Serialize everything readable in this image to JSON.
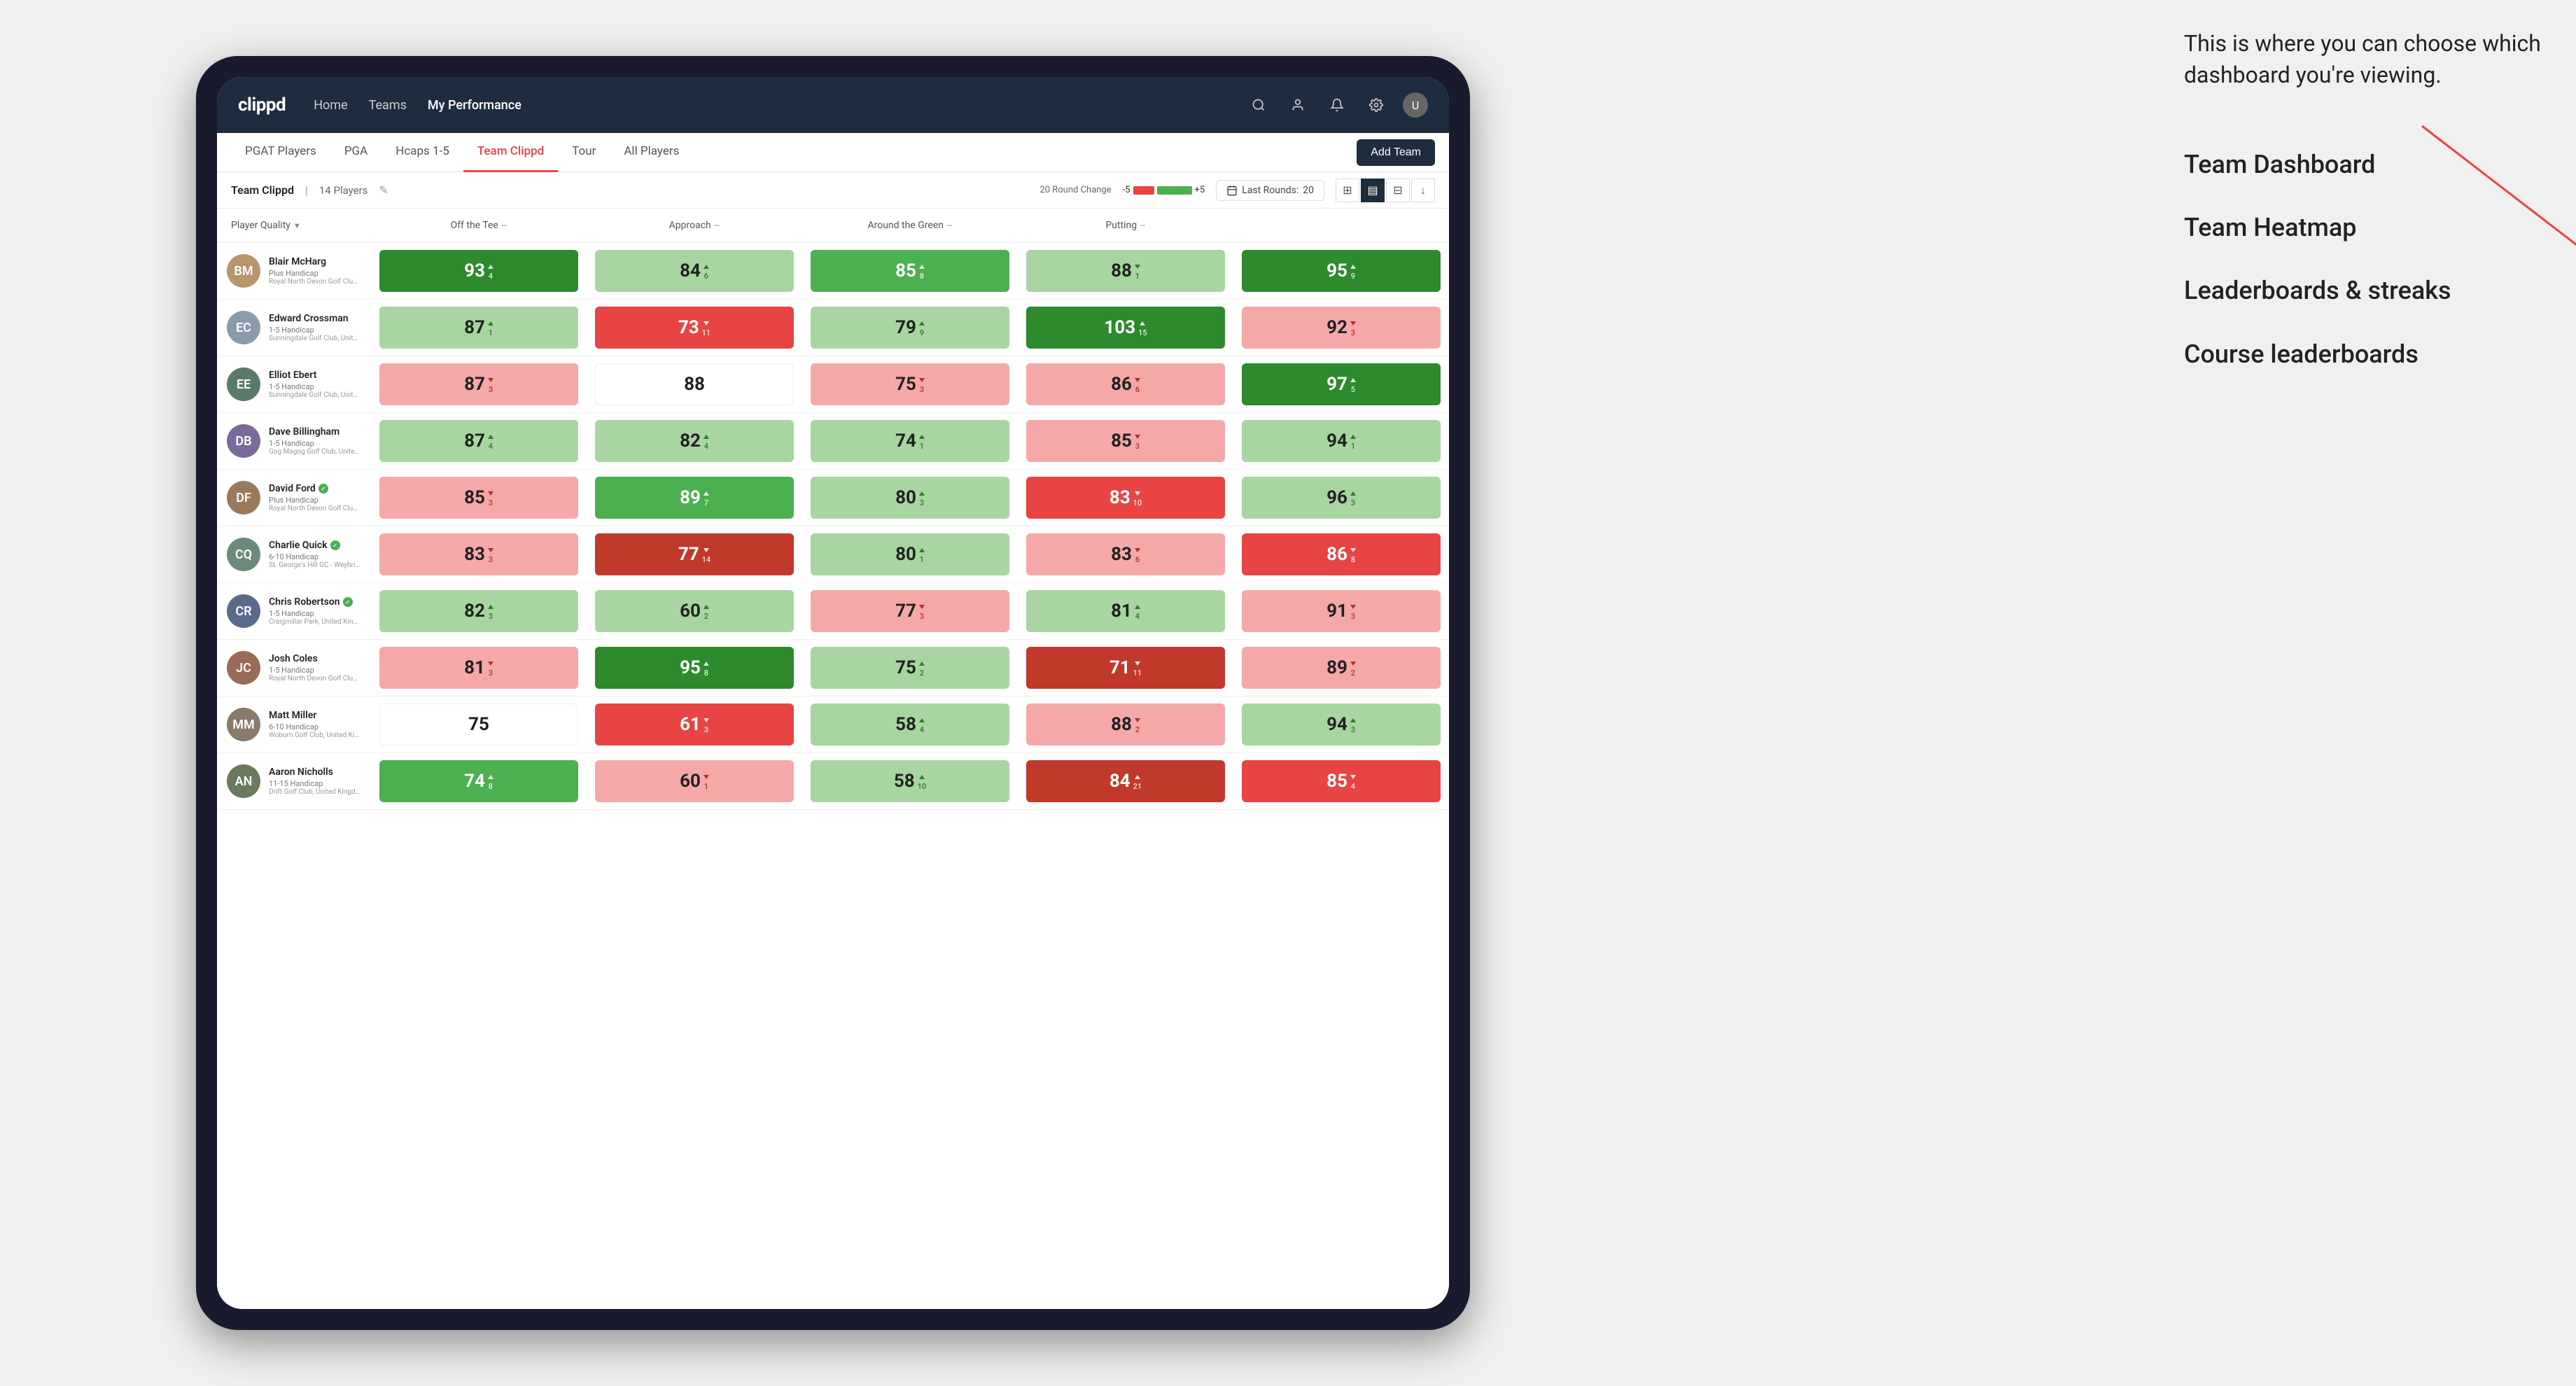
{
  "annotation": {
    "text": "This is where you can choose which dashboard you're viewing.",
    "options": [
      "Team Dashboard",
      "Team Heatmap",
      "Leaderboards & streaks",
      "Course leaderboards"
    ]
  },
  "navbar": {
    "logo": "clippd",
    "links": [
      {
        "label": "Home",
        "active": false
      },
      {
        "label": "Teams",
        "active": false
      },
      {
        "label": "My Performance",
        "active": true
      }
    ],
    "icons": [
      "search",
      "person",
      "notifications",
      "settings",
      "avatar"
    ]
  },
  "subnav": {
    "tabs": [
      {
        "label": "PGAT Players",
        "active": false
      },
      {
        "label": "PGA",
        "active": false
      },
      {
        "label": "Hcaps 1-5",
        "active": false
      },
      {
        "label": "Team Clippd",
        "active": true
      },
      {
        "label": "Tour",
        "active": false
      },
      {
        "label": "All Players",
        "active": false
      }
    ],
    "add_team_label": "Add Team"
  },
  "team_bar": {
    "name": "Team Clippd",
    "separator": "|",
    "count": "14 Players",
    "round_change_label": "20 Round Change",
    "range_neg": "-5",
    "range_pos": "+5",
    "last_rounds_label": "Last Rounds:",
    "last_rounds_value": "20"
  },
  "table": {
    "columns": [
      {
        "label": "Player Quality",
        "sortable": true
      },
      {
        "label": "Off the Tee",
        "sortable": true
      },
      {
        "label": "Approach",
        "sortable": true
      },
      {
        "label": "Around the Green",
        "sortable": true
      },
      {
        "label": "Putting",
        "sortable": true
      }
    ],
    "players": [
      {
        "name": "Blair McHarg",
        "handicap": "Plus Handicap",
        "club": "Royal North Devon Golf Club, United Kingdom",
        "avatar_color": "#b8956a",
        "avatar_initials": "BM",
        "verified": false,
        "scores": [
          {
            "value": 93,
            "change": 4,
            "dir": "up",
            "bg": "green-strong"
          },
          {
            "value": 84,
            "change": 6,
            "dir": "up",
            "bg": "green-light"
          },
          {
            "value": 85,
            "change": 8,
            "dir": "up",
            "bg": "green-medium"
          },
          {
            "value": 88,
            "change": 1,
            "dir": "down",
            "bg": "green-light"
          },
          {
            "value": 95,
            "change": 9,
            "dir": "up",
            "bg": "green-strong"
          }
        ]
      },
      {
        "name": "Edward Crossman",
        "handicap": "1-5 Handicap",
        "club": "Sunningdale Golf Club, United Kingdom",
        "avatar_color": "#8a9baa",
        "avatar_initials": "EC",
        "verified": false,
        "scores": [
          {
            "value": 87,
            "change": 1,
            "dir": "up",
            "bg": "green-light"
          },
          {
            "value": 73,
            "change": 11,
            "dir": "down",
            "bg": "red-medium"
          },
          {
            "value": 79,
            "change": 9,
            "dir": "up",
            "bg": "green-light"
          },
          {
            "value": 103,
            "change": 15,
            "dir": "up",
            "bg": "green-strong"
          },
          {
            "value": 92,
            "change": 3,
            "dir": "down",
            "bg": "red-light"
          }
        ]
      },
      {
        "name": "Elliot Ebert",
        "handicap": "1-5 Handicap",
        "club": "Sunningdale Golf Club, United Kingdom",
        "avatar_color": "#5a7a6a",
        "avatar_initials": "EE",
        "verified": false,
        "scores": [
          {
            "value": 87,
            "change": 3,
            "dir": "down",
            "bg": "red-light"
          },
          {
            "value": 88,
            "change": null,
            "dir": null,
            "bg": "white"
          },
          {
            "value": 75,
            "change": 3,
            "dir": "down",
            "bg": "red-light"
          },
          {
            "value": 86,
            "change": 6,
            "dir": "down",
            "bg": "red-light"
          },
          {
            "value": 97,
            "change": 5,
            "dir": "up",
            "bg": "green-strong"
          }
        ]
      },
      {
        "name": "Dave Billingham",
        "handicap": "1-5 Handicap",
        "club": "Gog Magog Golf Club, United Kingdom",
        "avatar_color": "#7a6a9a",
        "avatar_initials": "DB",
        "verified": false,
        "scores": [
          {
            "value": 87,
            "change": 4,
            "dir": "up",
            "bg": "green-light"
          },
          {
            "value": 82,
            "change": 4,
            "dir": "up",
            "bg": "green-light"
          },
          {
            "value": 74,
            "change": 1,
            "dir": "up",
            "bg": "green-light"
          },
          {
            "value": 85,
            "change": 3,
            "dir": "down",
            "bg": "red-light"
          },
          {
            "value": 94,
            "change": 1,
            "dir": "up",
            "bg": "green-light"
          }
        ]
      },
      {
        "name": "David Ford",
        "handicap": "Plus Handicap",
        "club": "Royal North Devon Golf Club, United Kingdom",
        "avatar_color": "#9a7a5a",
        "avatar_initials": "DF",
        "verified": true,
        "scores": [
          {
            "value": 85,
            "change": 3,
            "dir": "down",
            "bg": "red-light"
          },
          {
            "value": 89,
            "change": 7,
            "dir": "up",
            "bg": "green-medium"
          },
          {
            "value": 80,
            "change": 3,
            "dir": "up",
            "bg": "green-light"
          },
          {
            "value": 83,
            "change": 10,
            "dir": "down",
            "bg": "red-medium"
          },
          {
            "value": 96,
            "change": 3,
            "dir": "up",
            "bg": "green-light"
          }
        ]
      },
      {
        "name": "Charlie Quick",
        "handicap": "6-10 Handicap",
        "club": "St. George's Hill GC - Weybridge - Surrey, Uni...",
        "avatar_color": "#6a8a7a",
        "avatar_initials": "CQ",
        "verified": true,
        "scores": [
          {
            "value": 83,
            "change": 3,
            "dir": "down",
            "bg": "red-light"
          },
          {
            "value": 77,
            "change": 14,
            "dir": "down",
            "bg": "red-strong"
          },
          {
            "value": 80,
            "change": 1,
            "dir": "up",
            "bg": "green-light"
          },
          {
            "value": 83,
            "change": 6,
            "dir": "down",
            "bg": "red-light"
          },
          {
            "value": 86,
            "change": 8,
            "dir": "down",
            "bg": "red-medium"
          }
        ]
      },
      {
        "name": "Chris Robertson",
        "handicap": "1-5 Handicap",
        "club": "Craigmillar Park, United Kingdom",
        "avatar_color": "#5a6a8a",
        "avatar_initials": "CR",
        "verified": true,
        "scores": [
          {
            "value": 82,
            "change": 3,
            "dir": "up",
            "bg": "green-light"
          },
          {
            "value": 60,
            "change": 2,
            "dir": "up",
            "bg": "green-light"
          },
          {
            "value": 77,
            "change": 3,
            "dir": "down",
            "bg": "red-light"
          },
          {
            "value": 81,
            "change": 4,
            "dir": "up",
            "bg": "green-light"
          },
          {
            "value": 91,
            "change": 3,
            "dir": "down",
            "bg": "red-light"
          }
        ]
      },
      {
        "name": "Josh Coles",
        "handicap": "1-5 Handicap",
        "club": "Royal North Devon Golf Club, United Kingdom",
        "avatar_color": "#9a6a5a",
        "avatar_initials": "JC",
        "verified": false,
        "scores": [
          {
            "value": 81,
            "change": 3,
            "dir": "down",
            "bg": "red-light"
          },
          {
            "value": 95,
            "change": 8,
            "dir": "up",
            "bg": "green-strong"
          },
          {
            "value": 75,
            "change": 2,
            "dir": "up",
            "bg": "green-light"
          },
          {
            "value": 71,
            "change": 11,
            "dir": "down",
            "bg": "red-strong"
          },
          {
            "value": 89,
            "change": 2,
            "dir": "down",
            "bg": "red-light"
          }
        ]
      },
      {
        "name": "Matt Miller",
        "handicap": "6-10 Handicap",
        "club": "Woburn Golf Club, United Kingdom",
        "avatar_color": "#8a7a6a",
        "avatar_initials": "MM",
        "verified": false,
        "scores": [
          {
            "value": 75,
            "change": null,
            "dir": null,
            "bg": "white"
          },
          {
            "value": 61,
            "change": 3,
            "dir": "down",
            "bg": "red-medium"
          },
          {
            "value": 58,
            "change": 4,
            "dir": "up",
            "bg": "green-light"
          },
          {
            "value": 88,
            "change": 2,
            "dir": "down",
            "bg": "red-light"
          },
          {
            "value": 94,
            "change": 3,
            "dir": "up",
            "bg": "green-light"
          }
        ]
      },
      {
        "name": "Aaron Nicholls",
        "handicap": "11-15 Handicap",
        "club": "Drift Golf Club, United Kingdom",
        "avatar_color": "#6a7a5a",
        "avatar_initials": "AN",
        "verified": false,
        "scores": [
          {
            "value": 74,
            "change": 8,
            "dir": "up",
            "bg": "green-medium"
          },
          {
            "value": 60,
            "change": 1,
            "dir": "down",
            "bg": "red-light"
          },
          {
            "value": 58,
            "change": 10,
            "dir": "up",
            "bg": "green-light"
          },
          {
            "value": 84,
            "change": 21,
            "dir": "up",
            "bg": "red-strong"
          },
          {
            "value": 85,
            "change": 4,
            "dir": "down",
            "bg": "red-medium"
          }
        ]
      }
    ]
  }
}
